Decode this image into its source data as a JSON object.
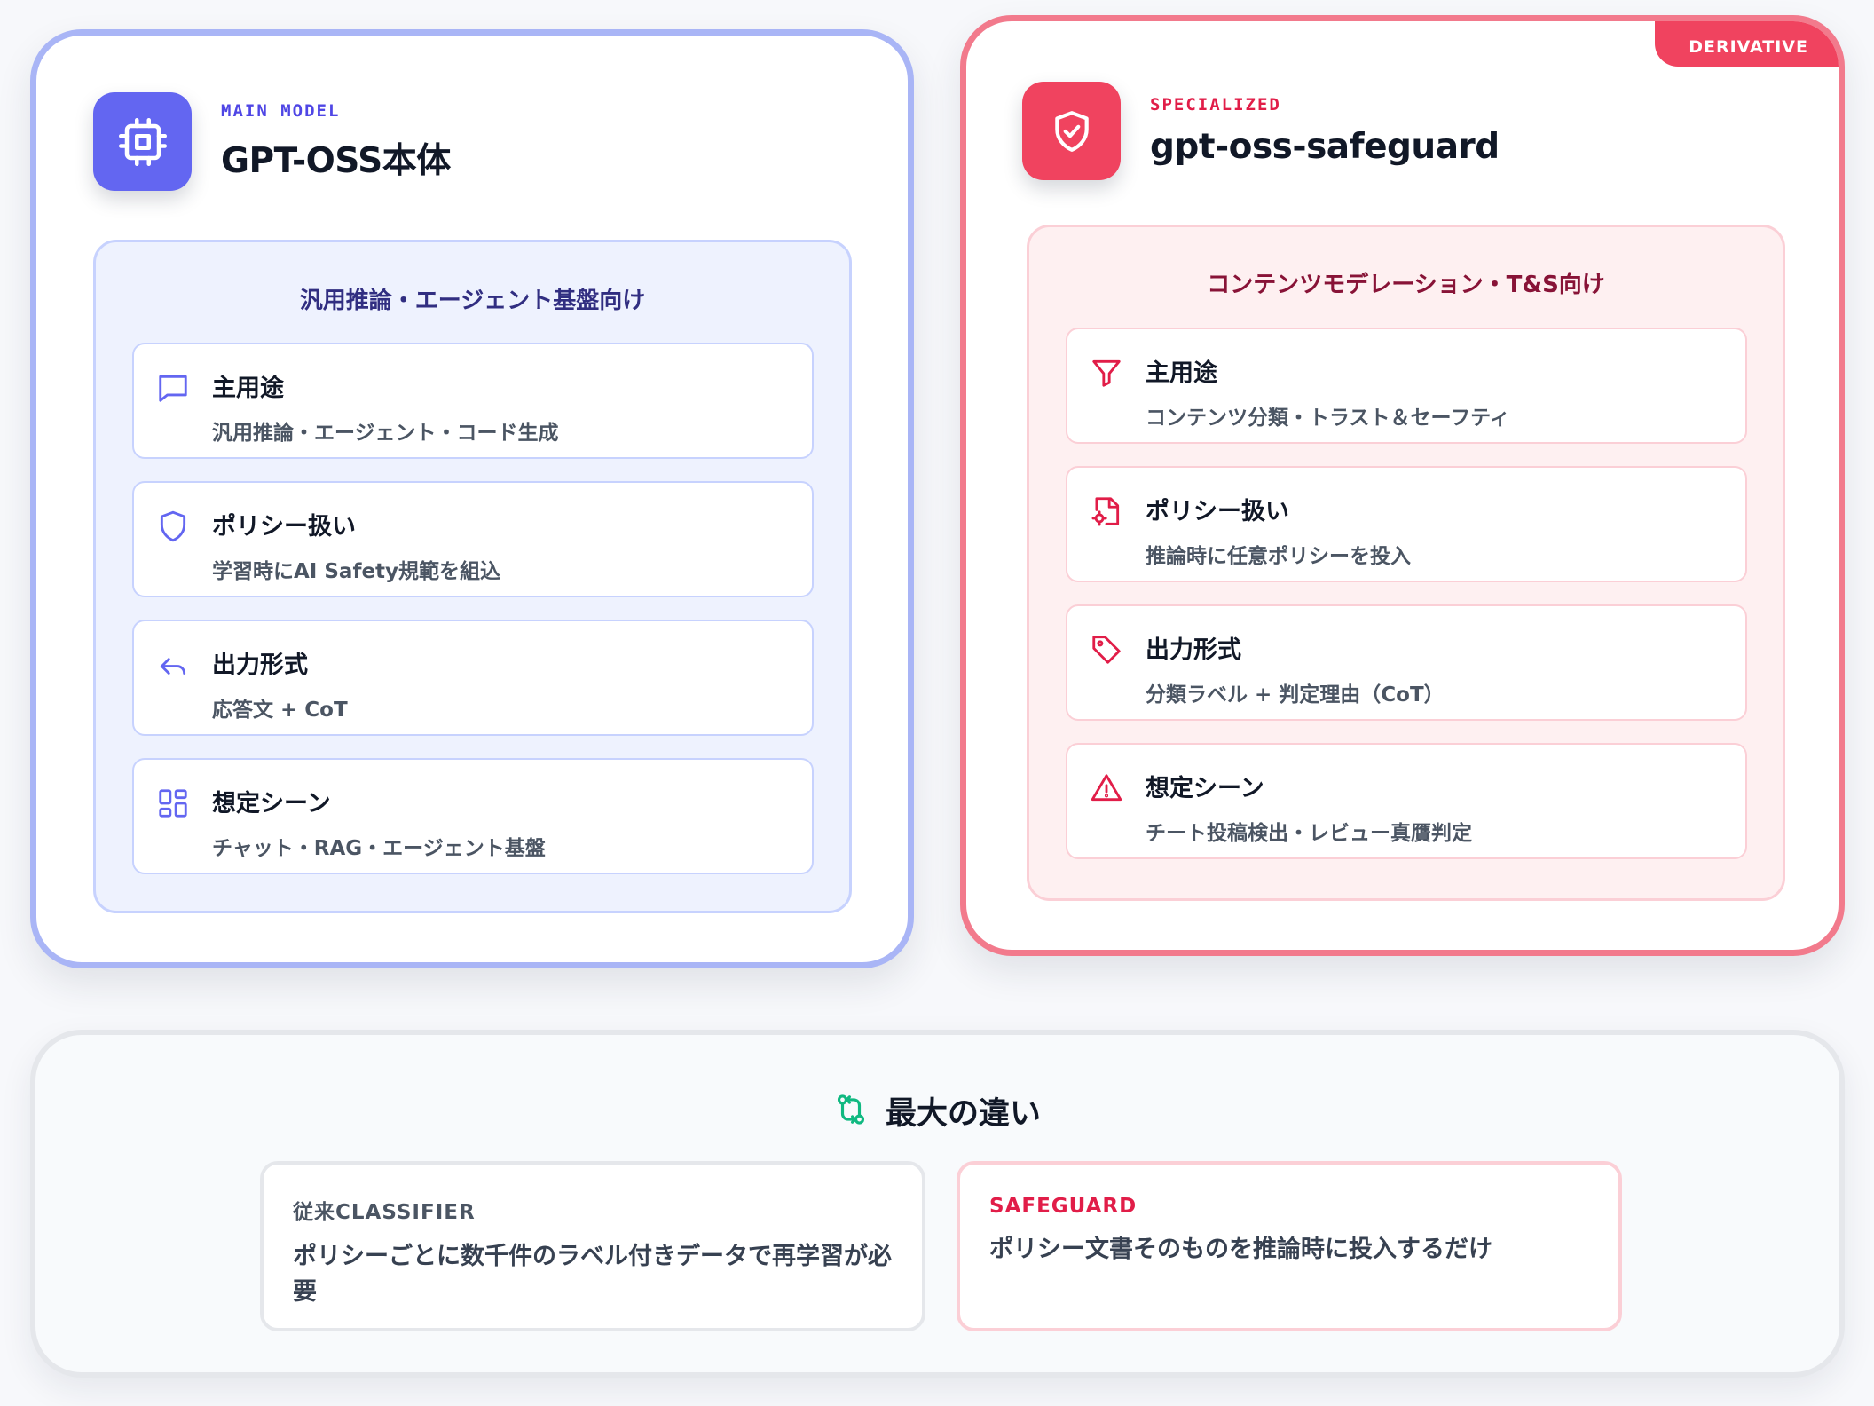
{
  "colors": {
    "main_accent": "#6366f1",
    "safe_accent": "#f0435f",
    "diff_icon": "#10b981"
  },
  "main": {
    "tag": "MAIN MODEL",
    "title": "GPT-OSS本体",
    "icon": "cpu-icon",
    "panel_title": "汎用推論・エージェント基盤向け",
    "items": [
      {
        "icon": "chat-icon",
        "label": "主用途",
        "value": "汎用推論・エージェント・コード生成"
      },
      {
        "icon": "shield-icon",
        "label": "ポリシー扱い",
        "value": "学習時にAI Safety規範を組込"
      },
      {
        "icon": "reply-arrow-icon",
        "label": "出力形式",
        "value": "応答文 + CoT"
      },
      {
        "icon": "grid-icon",
        "label": "想定シーン",
        "value": "チャット・RAG・エージェント基盤"
      }
    ]
  },
  "safeguard": {
    "badge": "DERIVATIVE",
    "tag": "SPECIALIZED",
    "title": "gpt-oss-safeguard",
    "icon": "shield-check-icon",
    "panel_title": "コンテンツモデレーション・T&S向け",
    "items": [
      {
        "icon": "filter-icon",
        "label": "主用途",
        "value": "コンテンツ分類・トラスト＆セーフティ"
      },
      {
        "icon": "file-gear-icon",
        "label": "ポリシー扱い",
        "value": "推論時に任意ポリシーを投入"
      },
      {
        "icon": "tag-icon",
        "label": "出力形式",
        "value": "分類ラベル + 判定理由（CoT）"
      },
      {
        "icon": "warning-icon",
        "label": "想定シーン",
        "value": "チート投稿検出・レビュー真贋判定"
      }
    ]
  },
  "difference": {
    "title": "最大の違い",
    "icon": "git-compare-icon",
    "old": {
      "tag": "従来CLASSIFIER",
      "text": "ポリシーごとに数千件のラベル付きデータで再学習が必要"
    },
    "new": {
      "tag": "SAFEGUARD",
      "text": "ポリシー文書そのものを推論時に投入するだけ"
    }
  }
}
